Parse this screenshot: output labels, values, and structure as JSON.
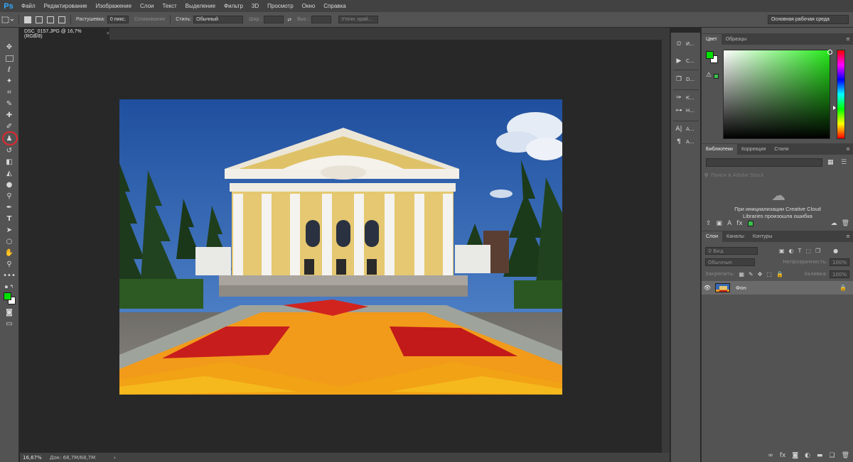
{
  "app": {
    "logo": "Ps"
  },
  "menu": [
    "Файл",
    "Редактирование",
    "Изображение",
    "Слои",
    "Текст",
    "Выделение",
    "Фильтр",
    "3D",
    "Просмотр",
    "Окно",
    "Справка"
  ],
  "options": {
    "feather_label": "Растушевка:",
    "feather_value": "0 пикс.",
    "antialias_label": "Сглаживание",
    "style_label": "Стиль:",
    "style_value": "Обычный",
    "width_label": "Шир.:",
    "height_label": "Выс.:",
    "refine_label": "Уточн. край...",
    "workspace": "Основная рабочая среда"
  },
  "document": {
    "tab_title": "DSC_0157.JPG @ 16,7% (RGB/8)",
    "tab_close": "×"
  },
  "status": {
    "zoom": "16,67%",
    "doc_size": "Док: 68,7M/68,7M",
    "arrow": "›"
  },
  "dock": [
    {
      "icon": "history-icon",
      "label": "И..."
    },
    {
      "icon": "actions-icon",
      "label": "С..."
    },
    {
      "icon": "layer-comps-icon",
      "label": "D..."
    },
    {
      "icon": "brushes-icon",
      "label": "К..."
    },
    {
      "icon": "clone-source-icon",
      "label": "Н..."
    },
    {
      "icon": "character-icon",
      "label": "А..."
    },
    {
      "icon": "paragraph-icon",
      "label": "А..."
    }
  ],
  "color_panel": {
    "tabs": [
      "Цвет",
      "Образцы"
    ],
    "fg": "#00e000",
    "bg": "#ffffff",
    "accent": "#25ea1a"
  },
  "libraries_panel": {
    "tabs": [
      "Библиотеки",
      "Коррекция",
      "Стили"
    ],
    "search_placeholder": "Поиск в Adobe Stock",
    "error_line1": "При инициализации Creative Cloud",
    "error_line2": "Libraries произошла ошибка"
  },
  "layers_panel": {
    "tabs": [
      "Слои",
      "Каналы",
      "Контуры"
    ],
    "filter_label": "Вид",
    "blend_mode": "Обычные",
    "opacity_label": "Непрозрачность:",
    "opacity_value": "100%",
    "lock_label": "Закрепить:",
    "fill_label": "Заливка:",
    "fill_value": "100%",
    "layer_name": "Фон"
  },
  "panel_menu_glyph": "≡"
}
